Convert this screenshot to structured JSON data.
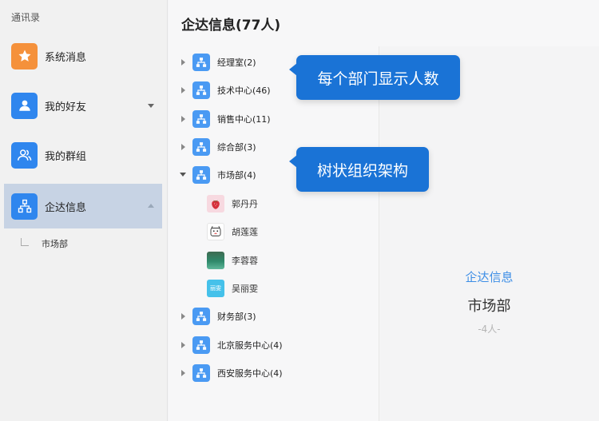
{
  "sidebar": {
    "title": "通讯录",
    "items": [
      {
        "label": "系统消息",
        "icon": "star-icon"
      },
      {
        "label": "我的好友",
        "icon": "user-icon"
      },
      {
        "label": "我的群组",
        "icon": "group-icon"
      },
      {
        "label": "企达信息",
        "icon": "org-chart-icon"
      }
    ],
    "sub_item": "市场部"
  },
  "main": {
    "title": "企达信息(77人)",
    "tree": [
      {
        "label": "经理室(2)",
        "expanded": false
      },
      {
        "label": "技术中心(46)",
        "expanded": false
      },
      {
        "label": "销售中心(11)",
        "expanded": false
      },
      {
        "label": "综合部(3)",
        "expanded": false
      },
      {
        "label": "市场部(4)",
        "expanded": true
      },
      {
        "label": "财务部(3)",
        "expanded": false
      },
      {
        "label": "北京服务中心(4)",
        "expanded": false
      },
      {
        "label": "西安服务中心(4)",
        "expanded": false
      }
    ],
    "members": [
      {
        "name": "郭丹丹",
        "avatar": "strawberry-avatar"
      },
      {
        "name": "胡莲莲",
        "avatar": "cartoon-avatar"
      },
      {
        "name": "李蓉蓉",
        "avatar": "landscape-avatar"
      },
      {
        "name": "吴丽雯",
        "avatar": "text-avatar",
        "avatar_text": "丽雯"
      }
    ],
    "detail": {
      "org": "企达信息",
      "dept": "市场部",
      "count": "-4人-"
    }
  },
  "callouts": [
    "每个部门显示人数",
    "树状组织架构"
  ],
  "colors": {
    "accent": "#2f86ee",
    "callout": "#1a73d6",
    "orange": "#f5913b",
    "active_bg": "#c7d3e4"
  }
}
